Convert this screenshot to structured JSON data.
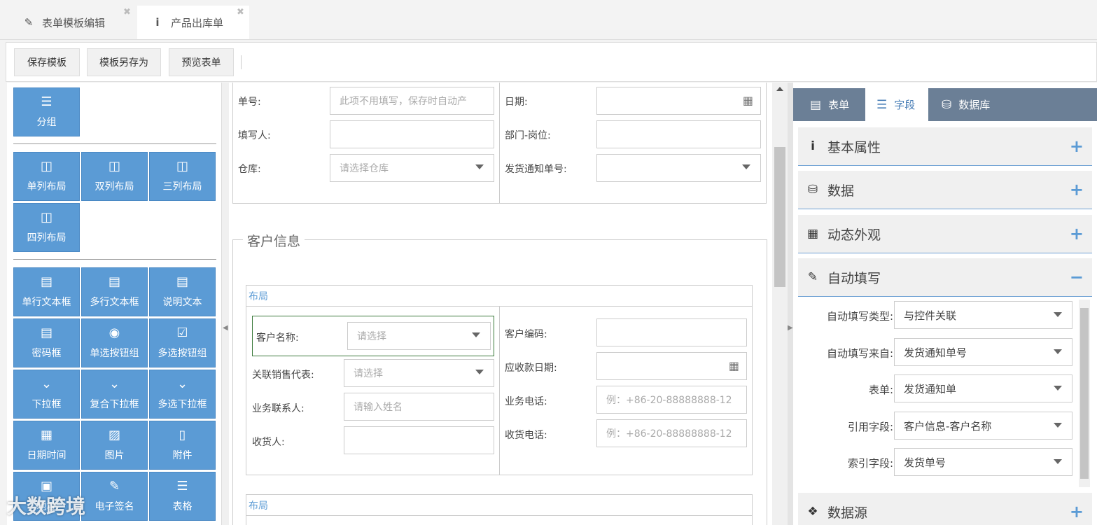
{
  "tabs": [
    {
      "label": "表单模板编辑",
      "icon": "edit-icon",
      "close": "✖"
    },
    {
      "label": "产品出库单",
      "icon": "info-icon",
      "close": "✖"
    }
  ],
  "toolbar": {
    "save_label": "保存模板",
    "save_as_label": "模板另存为",
    "preview_label": "预览表单"
  },
  "palette": {
    "group": "分组",
    "layouts": [
      "单列布局",
      "双列布局",
      "三列布局",
      "四列布局"
    ],
    "controls": [
      "单行文本框",
      "多行文本框",
      "说明文本",
      "密码框",
      "单选按钮组",
      "多选按钮组",
      "下拉框",
      "复合下拉框",
      "多选下拉框",
      "日期时间",
      "图片",
      "附件",
      "地址",
      "电子签名",
      "表格"
    ]
  },
  "form": {
    "order_no_label": "单号:",
    "order_no_placeholder": "此项不用填写，保存时自动产",
    "date_label": "日期:",
    "filler_label": "填写人:",
    "dept_label": "部门-岗位:",
    "warehouse_label": "仓库:",
    "warehouse_placeholder": "请选择仓库",
    "notice_label": "发货通知单号:",
    "customer_section": "客户信息",
    "layout_label": "布局",
    "customer_name_label": "客户名称:",
    "customer_name_placeholder": "请选择",
    "customer_code_label": "客户编码:",
    "sales_rep_label": "关联销售代表:",
    "sales_rep_placeholder": "请选择",
    "receivable_date_label": "应收款日期:",
    "contact_label": "业务联系人:",
    "contact_placeholder": "请输入姓名",
    "biz_phone_label": "业务电话:",
    "biz_phone_placeholder": "例：+86-20-88888888-12",
    "receiver_label": "收货人:",
    "recv_phone_label": "收货电话:",
    "recv_phone_placeholder": "例：+86-20-88888888-12",
    "layout2_label": "布局"
  },
  "right_panel": {
    "tabs": [
      "表单",
      "字段",
      "数据库"
    ],
    "sections": [
      "基本属性",
      "数据",
      "动态外观",
      "自动填写",
      "数据源"
    ],
    "auto_fill": {
      "type_label": "自动填写类型:",
      "type_value": "与控件关联",
      "from_label": "自动填写来自:",
      "from_value": "发货通知单号",
      "form_label": "表单:",
      "form_value": "发货通知单",
      "ref_label": "引用字段:",
      "ref_value": "客户信息-客户名称",
      "index_label": "索引字段:",
      "index_value": "发货单号"
    }
  },
  "watermark": "大数跨境",
  "colors": {
    "accent": "#5b9bd5",
    "tab_bar": "#6b7f96"
  }
}
